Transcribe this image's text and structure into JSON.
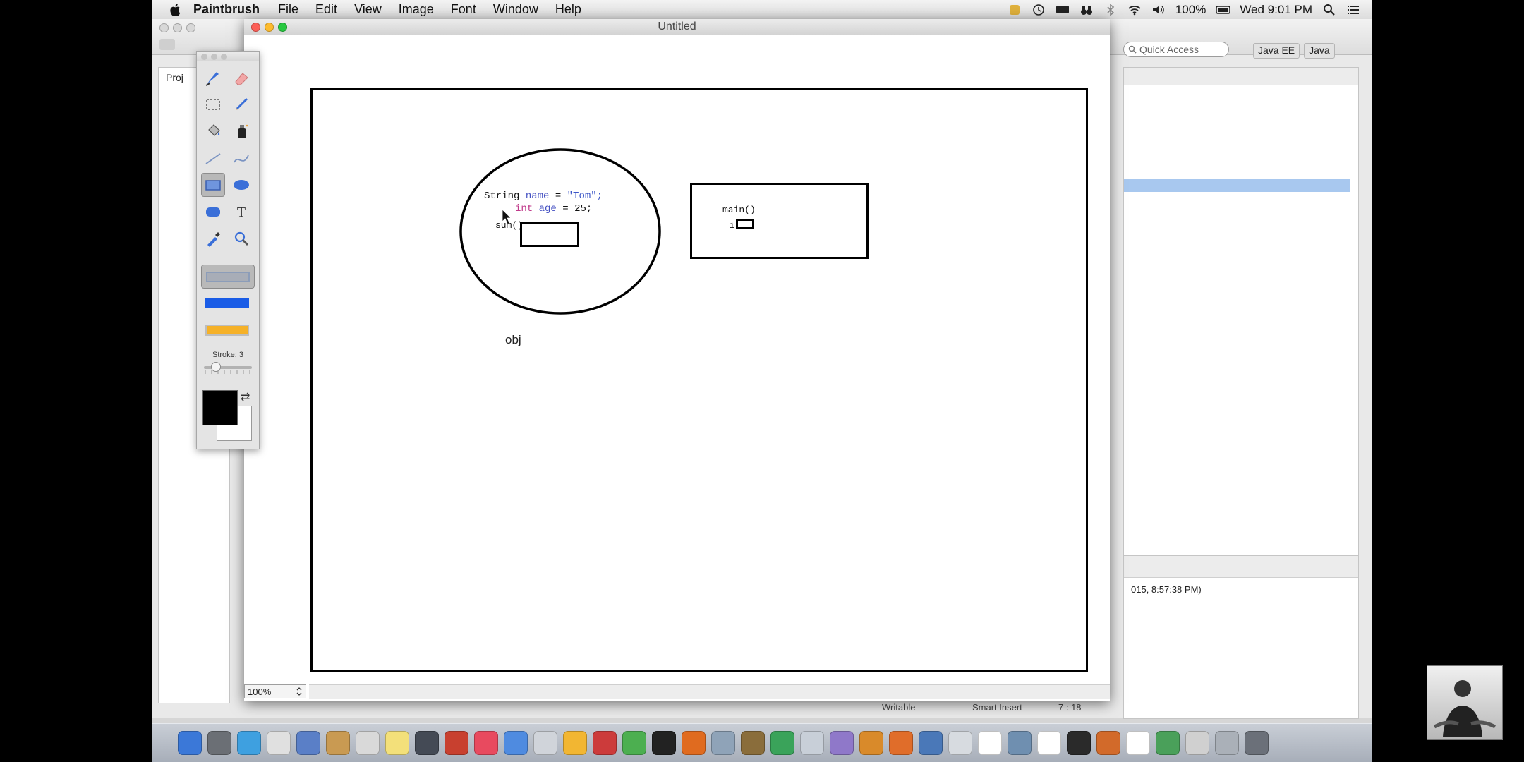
{
  "menubar": {
    "app_name": "Paintbrush",
    "menus": [
      "File",
      "Edit",
      "View",
      "Image",
      "Font",
      "Window",
      "Help"
    ],
    "battery": "100%",
    "clock": "Wed 9:01 PM"
  },
  "eclipse": {
    "quick_access_placeholder": "Quick Access",
    "perspectives": [
      "Java EE",
      "Java"
    ],
    "project_tab_partial": "Proj",
    "console_timestamp_partial": "015, 8:57:38 PM)",
    "status": {
      "writable": "Writable",
      "insert_mode": "Smart Insert",
      "cursor_pos": "7 : 18"
    }
  },
  "document": {
    "title": "Untitled",
    "zoom": "100%"
  },
  "drawing": {
    "code": {
      "line1": {
        "type": "String",
        "name": "name",
        "eq": " = ",
        "value": "\"Tom\";"
      },
      "line2": {
        "type": "int",
        "name": "age",
        "eq": " = ",
        "value": "25;"
      }
    },
    "sum_label": "sum()",
    "obj_label": "obj",
    "main_label": "main()",
    "i_label": "i"
  },
  "palette": {
    "stroke_label": "Stroke: 3",
    "stroke_value": 3,
    "fill_colors": {
      "outline": "#a8adb7",
      "fill": "#1a5ce6",
      "outline_fill": "#f5b128"
    },
    "foreground_color": "#000000",
    "background_color": "#ffffff",
    "tools": [
      "paintbrush-icon",
      "eraser-icon",
      "rect-select-icon",
      "pencil-icon",
      "paint-bucket-icon",
      "spray-icon",
      "line-icon",
      "curve-icon",
      "rectangle-icon",
      "ellipse-icon",
      "rounded-rect-icon",
      "text-icon",
      "eyedropper-icon",
      "zoom-icon"
    ],
    "selected_tool": "rectangle-icon"
  },
  "dock": {
    "app_colors": [
      "#3b78d8",
      "#6b6f75",
      "#3ea0e0",
      "#e0e0e0",
      "#5a7fc7",
      "#c99a52",
      "#d9d9d9",
      "#f3e07a",
      "#444a55",
      "#c8402f",
      "#e84a5f",
      "#4f8be0",
      "#d0d4da",
      "#f2b632",
      "#cc3b3b",
      "#4caf50",
      "#222222",
      "#e06b1f",
      "#8fa3b8",
      "#8a6d3b",
      "#3aa35a",
      "#c8cfd8",
      "#8f78c9",
      "#d98a2a",
      "#e06d2a",
      "#4a78b8",
      "#d7dbe0",
      "#ffffff",
      "#6f8fb0",
      "#ffffff",
      "#2a2a2a",
      "#d26a2a",
      "#ffffff",
      "#4aa05a",
      "#d0d0d0",
      "#aab0b8",
      "#6b7079"
    ]
  }
}
